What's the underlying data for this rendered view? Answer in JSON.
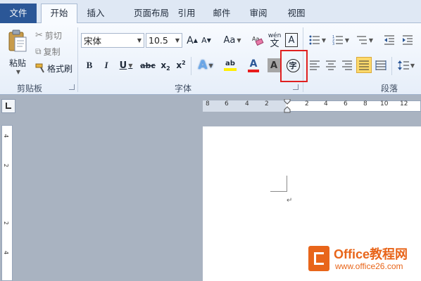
{
  "tabs": {
    "file": "文件",
    "home": "开始",
    "insert": "插入",
    "layout": "页面布局",
    "references": "引用",
    "mailings": "邮件",
    "review": "审阅",
    "view": "视图"
  },
  "clipboard": {
    "paste": "粘贴",
    "cut": "剪切",
    "copy": "复制",
    "format_painter": "格式刷",
    "group_label": "剪贴板"
  },
  "font": {
    "font_name": "宋体",
    "font_size": "10.5",
    "grow": "A",
    "shrink": "A",
    "change_case": "Aa",
    "pinyin": "wén",
    "pinyin_char": "文",
    "border_char": "A",
    "bold": "B",
    "italic": "I",
    "underline": "U",
    "strike": "abc",
    "subscript": "x",
    "superscript": "x",
    "sub_mark": "2",
    "sup_mark": "2",
    "text_effect": "A",
    "highlight": "ab",
    "font_color": "A",
    "shading": "A",
    "enclose": "字",
    "group_label": "字体"
  },
  "paragraph": {
    "group_label": "段落"
  },
  "ruler": {
    "numbers": [
      "8",
      "6",
      "4",
      "2",
      "2",
      "4",
      "6",
      "8",
      "10",
      "12"
    ],
    "vnumbers": [
      "4",
      "2",
      "2",
      "4"
    ]
  },
  "watermark": {
    "brand": "Office教程网",
    "url": "www.office26.com"
  },
  "colors": {
    "file_tab": "#2b5797",
    "highlight_box": "#e02020",
    "accent_orange": "#e8651a"
  }
}
